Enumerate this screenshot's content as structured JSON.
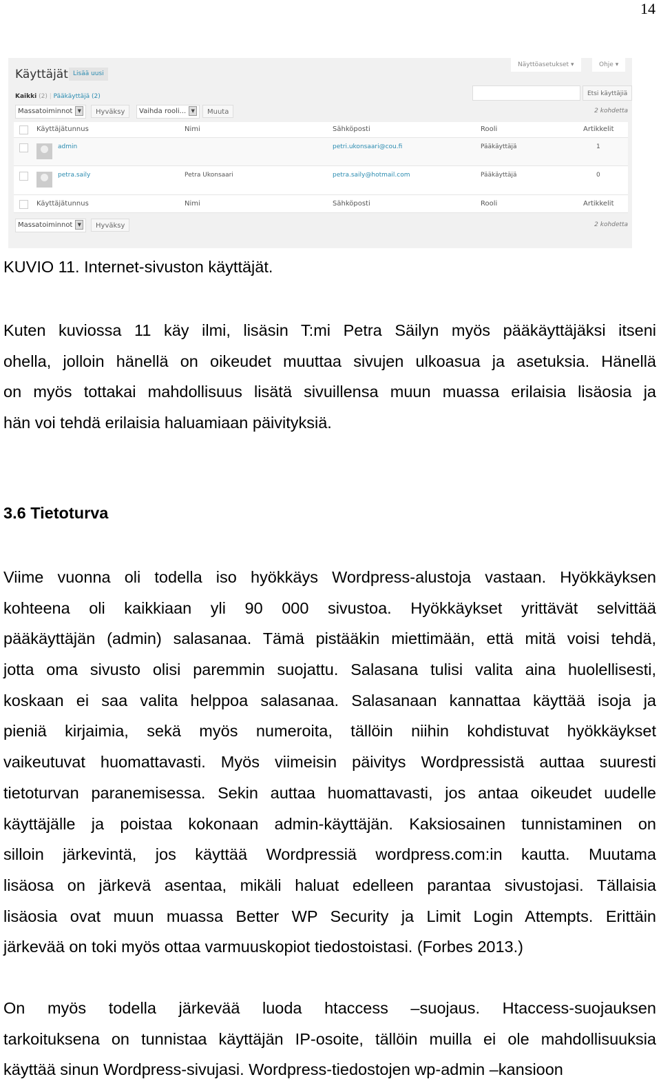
{
  "page_number": "14",
  "screenshot": {
    "title": "Käyttäjät",
    "add_new": "Lisää uusi",
    "screen_options": "Näyttöasetukset",
    "help": "Ohje",
    "filter_all": "Kaikki",
    "filter_all_count": "(2)",
    "filter_sep": "|",
    "filter_admin": "Pääkäyttäjä",
    "filter_admin_count": "(2)",
    "bulk_actions": "Massatoiminnot",
    "apply": "Hyväksy",
    "change_role": "Vaihda rooli...",
    "change": "Muuta",
    "search_value": "",
    "search_button": "Etsi käyttäjiä",
    "item_count": "2 kohdetta",
    "columns": [
      "Käyttäjätunnus",
      "Nimi",
      "Sähköposti",
      "Rooli",
      "Artikkelit"
    ],
    "rows": [
      {
        "username": "admin",
        "name": "",
        "email": "petri.ukonsaari@cou.fi",
        "role": "Pääkäyttäjä",
        "posts": "1"
      },
      {
        "username": "petra.saily",
        "name": "Petra Ukonsaari",
        "email": "petra.saily@hotmail.com",
        "role": "Pääkäyttäjä",
        "posts": "0"
      }
    ]
  },
  "caption": "KUVIO 11. Internet-sivuston käyttäjät.",
  "paragraph1": [
    "Kuten kuviossa 11 käy ilmi, lisäsin T:mi Petra Säilyn myös pääkäyttäjäksi itseni",
    "ohella, jolloin hänellä on oikeudet muuttaa sivujen ulkoasua ja asetuksia. Hänellä",
    "on myös tottakai mahdollisuus lisätä sivuillensa muun muassa erilaisia lisäosia ja",
    "hän voi tehdä erilaisia haluamiaan päivityksiä."
  ],
  "heading": "3.6 Tietoturva",
  "paragraph2": [
    "Viime vuonna oli todella iso hyökkäys Wordpress-alustoja vastaan. Hyökkäyksen",
    "kohteena oli kaikkiaan yli 90 000 sivustoa. Hyökkäykset yrittävät selvittää",
    "pääkäyttäjän (admin) salasanaa. Tämä pistääkin miettimään, että mitä voisi tehdä,",
    "jotta oma sivusto olisi paremmin suojattu. Salasana tulisi valita aina huolellisesti,",
    "koskaan ei saa valita helppoa salasanaa. Salasanaan kannattaa käyttää isoja ja",
    "pieniä kirjaimia, sekä myös numeroita, tällöin niihin kohdistuvat hyökkäykset",
    "vaikeutuvat huomattavasti. Myös viimeisin päivitys Wordpressistä auttaa suuresti",
    "tietoturvan paranemisessa. Sekin auttaa huomattavasti, jos antaa oikeudet uudelle",
    "käyttäjälle ja poistaa kokonaan admin-käyttäjän. Kaksiosainen tunnistaminen on",
    "silloin järkevintä, jos käyttää Wordpressiä wordpress.com:in kautta. Muutama",
    "lisäosa on järkevä asentaa, mikäli haluat edelleen parantaa sivustojasi. Tällaisia",
    "lisäosia ovat muun muassa Better WP Security ja Limit Login Attempts. Erittäin",
    "järkevää on toki myös ottaa varmuuskopiot tiedostoistasi. (Forbes 2013.)"
  ],
  "paragraph3": [
    "On myös todella järkevää luoda htaccess –suojaus. Htaccess-suojauksen",
    "tarkoituksena on tunnistaa käyttäjän IP-osoite, tällöin muilla ei ole mahdollisuuksia",
    "käyttää sinun Wordpress-sivujasi. Wordpress-tiedostojen wp-admin –kansioon"
  ]
}
